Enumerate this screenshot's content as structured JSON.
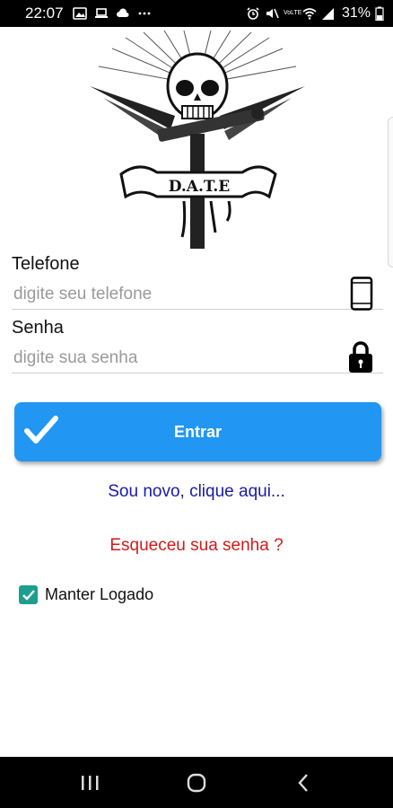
{
  "status_bar": {
    "time": "22:07",
    "left_icons": [
      "image-icon",
      "laptop-icon",
      "cloud-icon",
      "more-icon"
    ],
    "right_icons": [
      "alarm-icon",
      "mute-icon",
      "volte-icon",
      "wifi-icon",
      "signal-icon"
    ],
    "volte_label": "VoLTE",
    "battery": "31%"
  },
  "logo": {
    "text": "D.A.T.E"
  },
  "form": {
    "phone_label": "Telefone",
    "phone_placeholder": "digite seu telefone",
    "phone_icon": "smartphone-icon",
    "password_label": "Senha",
    "password_placeholder": "digite sua senha",
    "password_icon": "lock-icon"
  },
  "enter_button": {
    "label": "Entrar",
    "icon": "checkmark-icon"
  },
  "links": {
    "new_user": "Sou novo, clique aqui...",
    "forgot_password": "Esqueceu sua senha ?"
  },
  "keep_logged": {
    "label": "Manter Logado",
    "checked": true
  },
  "nav_bar": {
    "buttons": [
      "recents-icon",
      "home-icon",
      "back-icon"
    ]
  },
  "colors": {
    "button": "#2196f3",
    "new_user_link": "#1a1aa6",
    "forgot_link": "#d11a1a",
    "checkbox": "#1e9e8e"
  }
}
